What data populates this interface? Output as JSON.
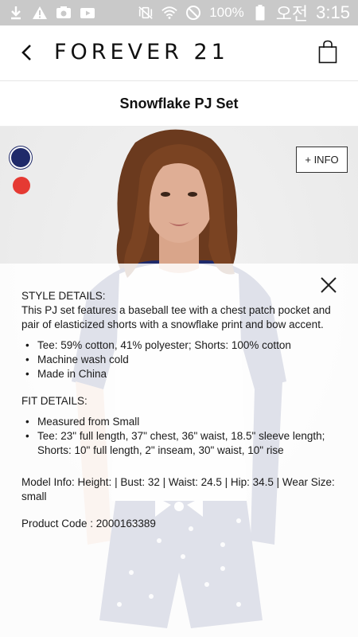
{
  "status_bar": {
    "battery_text": "100%",
    "carrier_text": "오전",
    "time": "3:15",
    "left_icons": [
      "download-icon",
      "warning-icon",
      "image-icon",
      "youtube-icon"
    ],
    "right_icons": [
      "vibrate-mute-icon",
      "wifi-icon",
      "block-icon",
      "battery-icon"
    ]
  },
  "header": {
    "brand": "FOREVER 21"
  },
  "product": {
    "title": "Snowflake PJ Set",
    "swatches": [
      {
        "name": "navy",
        "color": "#1f2a6a",
        "selected": true
      },
      {
        "name": "red",
        "color": "#e53a33",
        "selected": false
      }
    ],
    "info_button": "+ INFO"
  },
  "details": {
    "style_heading": "STYLE DETAILS:",
    "style_description": "This PJ set features a baseball tee with a chest patch pocket and pair of elasticized shorts with a snowflake print and bow accent.",
    "style_bullets": [
      "Tee: 59% cotton, 41% polyester; Shorts: 100% cotton",
      "Machine wash cold",
      "Made in China"
    ],
    "fit_heading": "FIT DETAILS:",
    "fit_bullets": [
      "Measured from Small",
      "Tee: 23\" full length, 37\" chest, 36\" waist, 18.5\" sleeve length; Shorts: 10\" full length, 2\" inseam, 30\" waist, 10\" rise"
    ],
    "model_info": "Model Info: Height: | Bust: 32 | Waist: 24.5 | Hip: 34.5 | Wear Size: small",
    "product_code": "Product Code : 2000163389"
  },
  "colors": {
    "navy": "#1f2a6a",
    "red": "#e53a33",
    "status_bar_bg": "#c9c9c9"
  }
}
